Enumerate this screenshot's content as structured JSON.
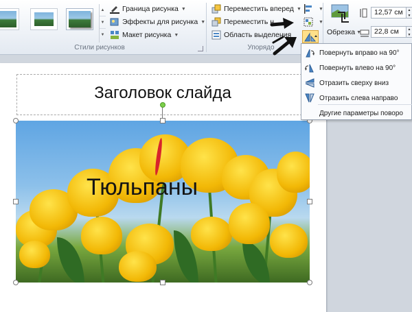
{
  "ribbon": {
    "picture_styles": {
      "group_label": "Стили рисунков",
      "border_label": "Граница рисунка",
      "effects_label": "Эффекты для рисунка",
      "layout_label": "Макет рисунка"
    },
    "arrange": {
      "group_label": "Упорядо",
      "bring_forward_label": "Переместить вперед",
      "send_backward_label": "Переместить н",
      "selection_pane_label": "Область выделения"
    },
    "size": {
      "crop_label": "Обрезка",
      "height_value": "12,57 см",
      "width_value": "22,8 см"
    }
  },
  "rotate_menu": {
    "items": [
      {
        "label": "Повернуть вправо на 90°"
      },
      {
        "label": "Повернуть влево на 90°"
      },
      {
        "label": "Отразить сверху вниз"
      },
      {
        "label": "Отразить слева направо"
      }
    ],
    "more_label": "Другие параметры поворо"
  },
  "slide": {
    "title": "Заголовок слайда",
    "picture_caption": "Тюльпаны"
  },
  "colors": {
    "accent": "#ffe08a",
    "selection_handle_rotate": "#7ccf4a"
  },
  "icons": [
    "border-icon",
    "effects-icon",
    "layout-icon",
    "bring-forward-icon",
    "send-backward-icon",
    "selection-pane-icon",
    "align-icon",
    "group-icon",
    "rotate-icon",
    "crop-icon",
    "height-icon",
    "width-icon"
  ]
}
